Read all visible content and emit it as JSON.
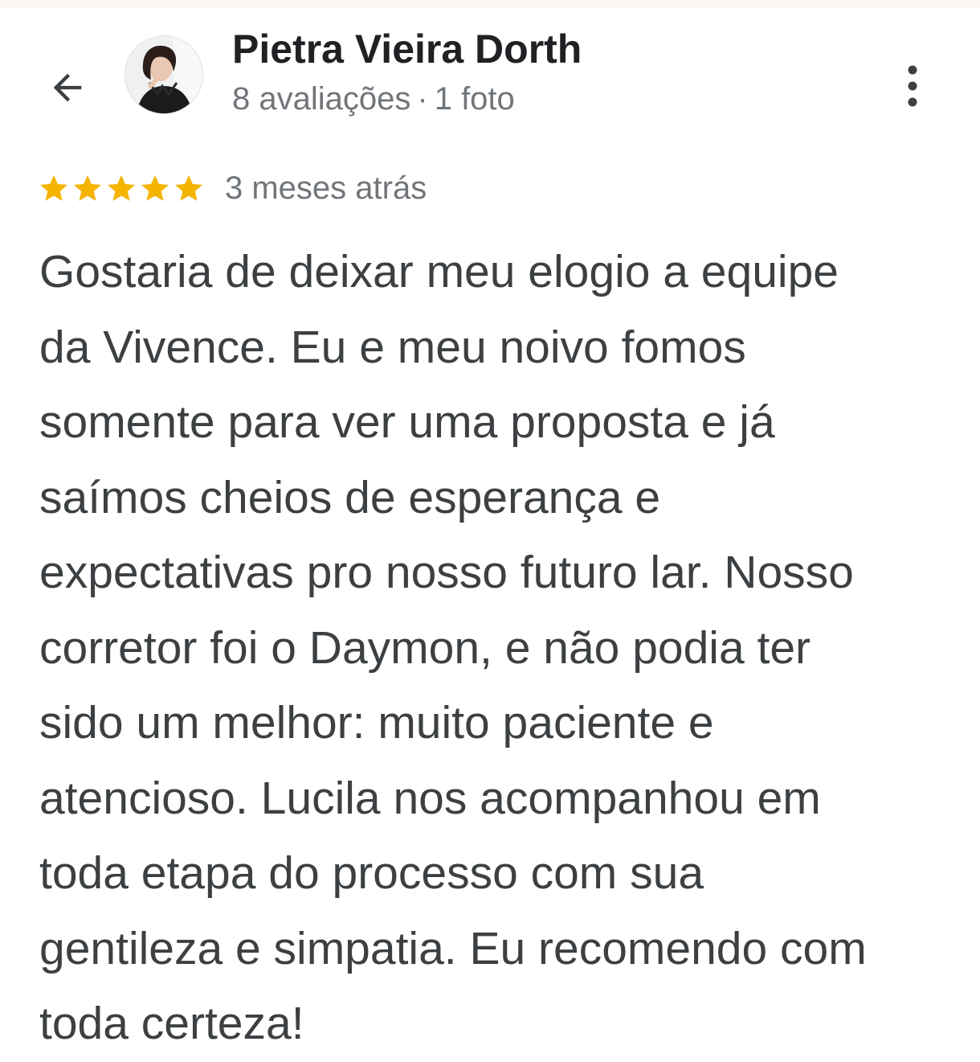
{
  "review": {
    "author_name": "Pietra Vieira Dorth",
    "reviews_count": "8 avaliações",
    "separator": "·",
    "photos_count": "1 foto",
    "rating": 5,
    "rating_max": 5,
    "date": "3 meses atrás",
    "text_lines": [
      "Gostaria de deixar meu elogio a equipe",
      "da Vivence. Eu e meu noivo fomos",
      "somente para ver uma proposta e já",
      "saímos cheios de esperança e",
      "expectativas pro nosso futuro lar. Nosso",
      "corretor foi o Daymon, e não podia ter",
      "sido um melhor: muito paciente e",
      "atencioso. Lucila nos acompanhou em",
      "toda etapa do processo com sua",
      "gentileza e simpatia. Eu recomendo com",
      "toda certeza!"
    ]
  },
  "icons": {
    "back": "arrow-back-icon",
    "more": "more-vertical-icon",
    "star": "star-icon"
  },
  "colors": {
    "star": "#f4b400",
    "name": "#202124",
    "secondary_text": "#70757a",
    "body_text": "#3c4043",
    "top_strip": "#fbf8f1"
  }
}
